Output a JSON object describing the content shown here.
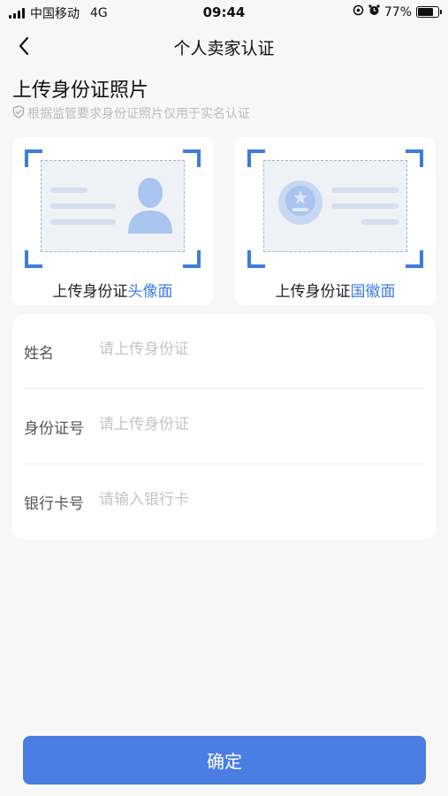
{
  "status_bar": {
    "carrier": "中国移动",
    "network": "4G",
    "time": "09:44",
    "battery": "77%",
    "battery_level": 0.77
  },
  "nav": {
    "title": "个人卖家认证",
    "back_icon": "chevron-left-icon"
  },
  "upload": {
    "title": "上传身份证照片",
    "notice": "根据监管要求身份证照片仅用于实名认证",
    "notice_icon": "shield-check-icon",
    "front": {
      "prefix": "上传身份证",
      "highlight": "头像面"
    },
    "back": {
      "prefix": "上传身份证",
      "highlight": "国徽面"
    }
  },
  "form": {
    "name": {
      "label": "姓名",
      "placeholder": "请上传身份证"
    },
    "id_number": {
      "label": "身份证号",
      "placeholder": "请上传身份证"
    },
    "bank_card": {
      "label": "银行卡号",
      "placeholder": "请输入银行卡"
    }
  },
  "confirm_label": "确定",
  "colors": {
    "accent": "#3e7be0",
    "button": "#4b7ee3",
    "placeholder": "#c2c4c8",
    "background": "#f7f7f8"
  }
}
